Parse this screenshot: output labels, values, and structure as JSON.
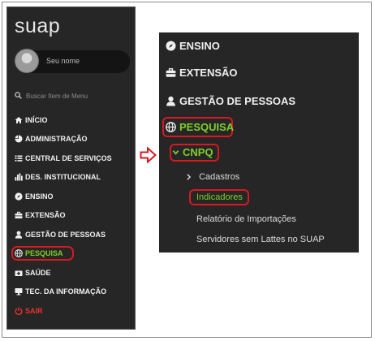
{
  "sidebar": {
    "logo": "suap",
    "user_name": "Seu nome",
    "search_placeholder": "Buscar Item de Menu",
    "items": [
      {
        "label": "INÍCIO",
        "icon": "home-icon"
      },
      {
        "label": "ADMINISTRAÇÃO",
        "icon": "pie-chart-icon"
      },
      {
        "label": "CENTRAL DE SERVIÇOS",
        "icon": "list-icon"
      },
      {
        "label": "DES. INSTITUCIONAL",
        "icon": "bar-chart-icon"
      },
      {
        "label": "ENSINO",
        "icon": "compass-icon"
      },
      {
        "label": "EXTENSÃO",
        "icon": "briefcase-icon"
      },
      {
        "label": "GESTÃO DE PESSOAS",
        "icon": "user-icon"
      },
      {
        "label": "PESQUISA",
        "icon": "globe-icon",
        "active": true
      },
      {
        "label": "SAÚDE",
        "icon": "medkit-icon"
      },
      {
        "label": "TEC. DA INFORMAÇÃO",
        "icon": "desktop-icon"
      },
      {
        "label": "SAIR",
        "icon": "power-icon"
      }
    ]
  },
  "zoom": {
    "ensino": "ENSINO",
    "extensao": "EXTENSÃO",
    "gestao": "GESTÃO DE PESSOAS",
    "pesquisa": "PESQUISA",
    "cnpq": "CNPQ",
    "cadastros": "Cadastros",
    "indicadores": "Indicadores",
    "relatorio": "Relatório de Importações",
    "servidores": "Servidores sem Lattes no SUAP"
  },
  "colors": {
    "sidebar_bg": "#262626",
    "active_green": "#7fcf2a",
    "highlight_red": "#d71920",
    "logout_red": "#e8332b"
  }
}
